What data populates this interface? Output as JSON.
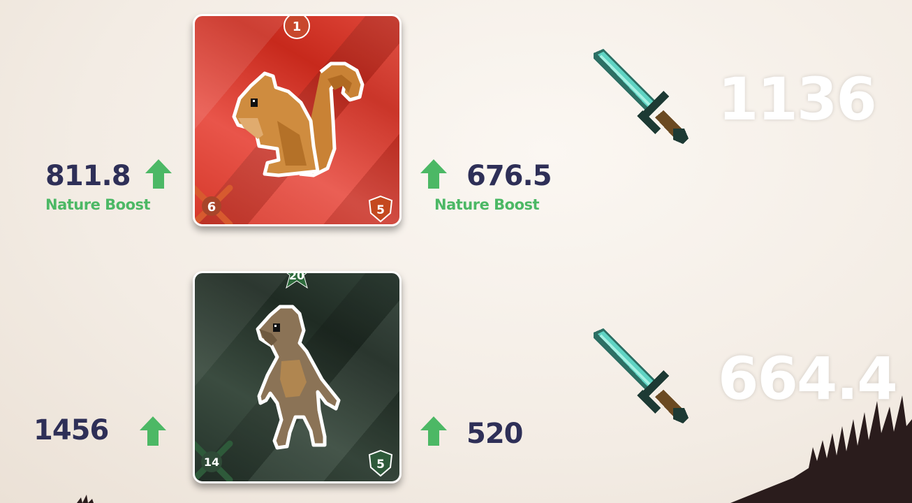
{
  "battle": [
    {
      "card": {
        "creature": "squirrel",
        "theme": "red",
        "top_badge": "1",
        "attack_badge": "6",
        "defense_badge": "5"
      },
      "left_stat": {
        "value": "811.8",
        "boost": "Nature Boost"
      },
      "right_stat": {
        "value": "676.5",
        "boost": "Nature Boost"
      },
      "score": "1136"
    },
    {
      "card": {
        "creature": "ape",
        "theme": "green",
        "top_badge": "20",
        "attack_badge": "14",
        "defense_badge": "5"
      },
      "left_stat": {
        "value": "1456"
      },
      "right_stat": {
        "value": "520"
      },
      "score": "664.4"
    }
  ],
  "icons": {
    "arrow": "up-arrow-icon",
    "sword": "diamond-sword-icon"
  },
  "colors": {
    "stat_text": "#2e2f57",
    "boost_green": "#4cb865",
    "sword_blade": "#5fd3c3"
  }
}
